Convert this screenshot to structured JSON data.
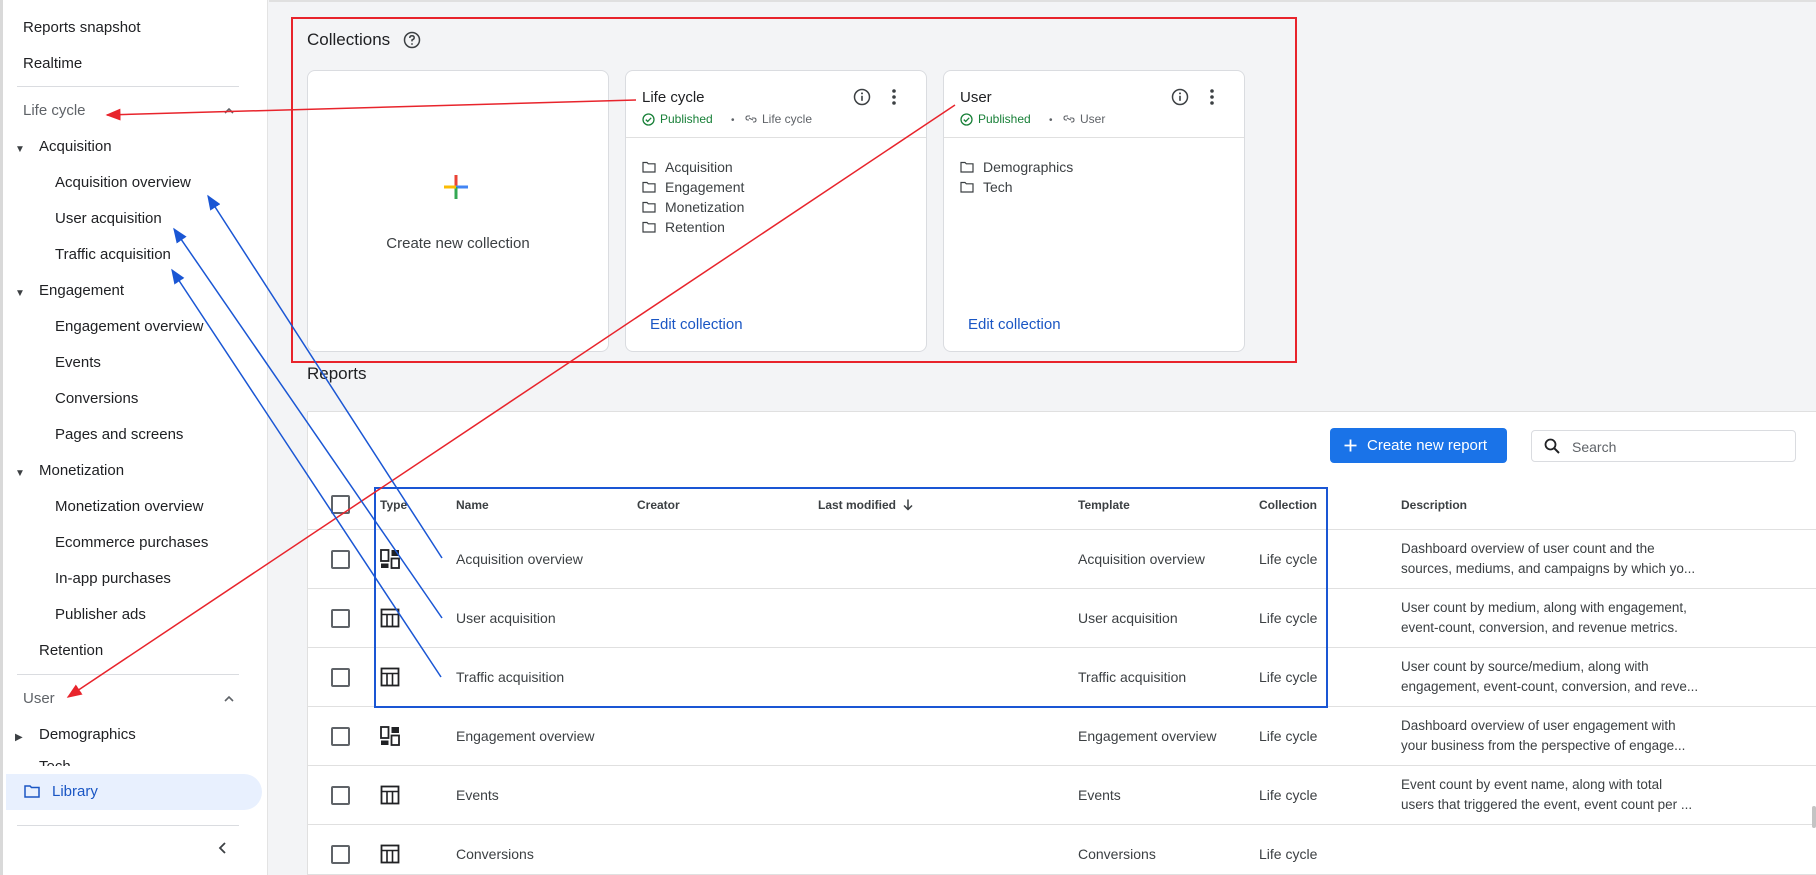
{
  "sidebar": {
    "reports_snapshot": "Reports snapshot",
    "realtime": "Realtime",
    "lifecycle_group": "Life cycle",
    "acquisition": "Acquisition",
    "acquisition_overview": "Acquisition overview",
    "user_acquisition": "User acquisition",
    "traffic_acquisition": "Traffic acquisition",
    "engagement": "Engagement",
    "engagement_overview": "Engagement overview",
    "events": "Events",
    "conversions": "Conversions",
    "pages_and_screens": "Pages and screens",
    "monetization": "Monetization",
    "monetization_overview": "Monetization overview",
    "ecommerce_purchases": "Ecommerce purchases",
    "in_app_purchases": "In-app purchases",
    "publisher_ads": "Publisher ads",
    "retention": "Retention",
    "user_group": "User",
    "demographics": "Demographics",
    "tech_clipped": "Tech",
    "library": "Library"
  },
  "collections": {
    "title": "Collections",
    "create_label": "Create new collection",
    "cards": [
      {
        "title": "Life cycle",
        "status": "Published",
        "category": "Life cycle",
        "folders": [
          "Acquisition",
          "Engagement",
          "Monetization",
          "Retention"
        ],
        "edit": "Edit collection"
      },
      {
        "title": "User",
        "status": "Published",
        "category": "User",
        "folders": [
          "Demographics",
          "Tech"
        ],
        "edit": "Edit collection"
      }
    ]
  },
  "reports": {
    "title": "Reports",
    "create_button": "Create new report",
    "search_placeholder": "Search",
    "columns": {
      "type": "Type",
      "name": "Name",
      "creator": "Creator",
      "last_modified": "Last modified",
      "template": "Template",
      "collection": "Collection",
      "description": "Description"
    },
    "rows": [
      {
        "icon": "dashboard-icon",
        "name": "Acquisition overview",
        "template": "Acquisition overview",
        "collection": "Life cycle",
        "desc1": "Dashboard overview of user count and the",
        "desc2": "sources, mediums, and campaigns by which yo..."
      },
      {
        "icon": "table-icon",
        "name": "User acquisition",
        "template": "User acquisition",
        "collection": "Life cycle",
        "desc1": "User count by medium, along with engagement,",
        "desc2": "event-count, conversion, and revenue metrics."
      },
      {
        "icon": "table-icon",
        "name": "Traffic acquisition",
        "template": "Traffic acquisition",
        "collection": "Life cycle",
        "desc1": "User count by source/medium, along with",
        "desc2": "engagement, event-count, conversion, and reve..."
      },
      {
        "icon": "dashboard-icon",
        "name": "Engagement overview",
        "template": "Engagement overview",
        "collection": "Life cycle",
        "desc1": "Dashboard overview of user engagement with",
        "desc2": "your business from the perspective of engage..."
      },
      {
        "icon": "table-icon",
        "name": "Events",
        "template": "Events",
        "collection": "Life cycle",
        "desc1": "Event count by event name, along with total",
        "desc2": "users that triggered the event, event count per ..."
      },
      {
        "icon": "table-icon",
        "name": "Conversions",
        "template": "Conversions",
        "collection": "Life cycle",
        "desc1": "",
        "desc2": ""
      }
    ]
  },
  "colors": {
    "accent_blue": "#1a73e8",
    "link_blue": "#1a56c4",
    "published_green": "#188038",
    "annotation_red": "#e8242c",
    "annotation_blue": "#1a56d4"
  }
}
